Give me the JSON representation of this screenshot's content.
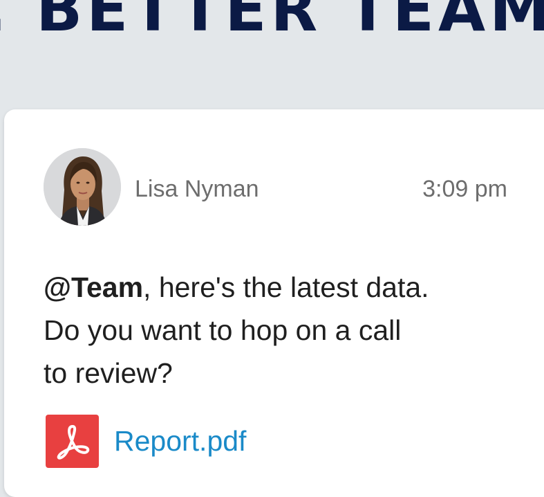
{
  "banner": {
    "headline": ". BETTER TEAM"
  },
  "post": {
    "author": "Lisa Nyman",
    "time": "3:09 pm",
    "message": {
      "mention": "@Team",
      "line1_rest": ", here's the latest data.",
      "line2": "Do you want to hop on a call",
      "line3": "to review?"
    },
    "attachment": {
      "file_name": "Report.pdf",
      "icon": "pdf-icon"
    }
  },
  "colors": {
    "page_background": "#e3e7ea",
    "headline": "#0b1a45",
    "card_background": "#ffffff",
    "meta_text": "#6d6d6d",
    "message_text": "#1f1f1f",
    "link": "#1a8ac8",
    "pdf_icon_bg": "#e84040"
  }
}
